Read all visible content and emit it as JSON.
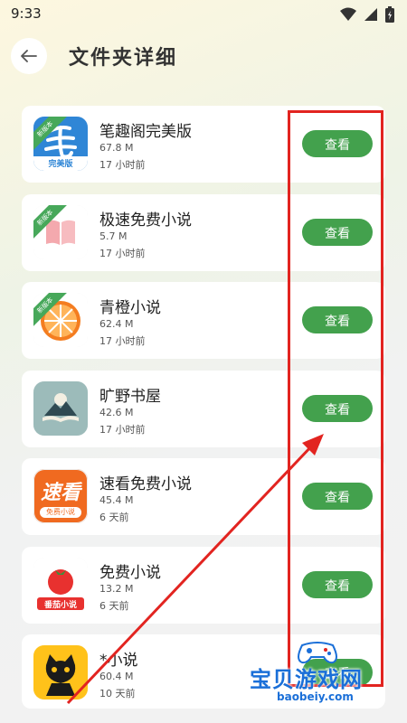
{
  "status": {
    "time": "9:33"
  },
  "header": {
    "title": "文件夹详细"
  },
  "apps": [
    {
      "name": "笔趣阁完美版",
      "size": "67.8 M",
      "time": "17 小时前",
      "badge": "新版本",
      "button": "查看"
    },
    {
      "name": "极速免费小说",
      "size": "5.7 M",
      "time": "17 小时前",
      "badge": "新版本",
      "button": "查看"
    },
    {
      "name": "青橙小说",
      "size": "62.4 M",
      "time": "17 小时前",
      "badge": "新版本",
      "button": "查看"
    },
    {
      "name": "旷野书屋",
      "size": "42.6 M",
      "time": "17 小时前",
      "badge": "",
      "button": "查看"
    },
    {
      "name": "速看免费小说",
      "size": "45.4 M",
      "time": "6 天前",
      "badge": "",
      "button": "查看"
    },
    {
      "name": "免费小说",
      "size": "13.2 M",
      "time": "6 天前",
      "badge": "",
      "button": "查看"
    },
    {
      "name": "*小说",
      "size": "60.4 M",
      "time": "10 天前",
      "badge": "",
      "button": "查看"
    }
  ],
  "icon_texts": {
    "biquge": "完美版",
    "sukan_main": "速看",
    "sukan_sub": "免费小说",
    "fanqie": "番茄小说"
  },
  "watermark": {
    "text": "宝贝游戏网",
    "url": "baobeiy.com"
  },
  "colors": {
    "accent": "#43a14d",
    "highlight": "#e22420",
    "watermark": "#1a6fd8"
  }
}
